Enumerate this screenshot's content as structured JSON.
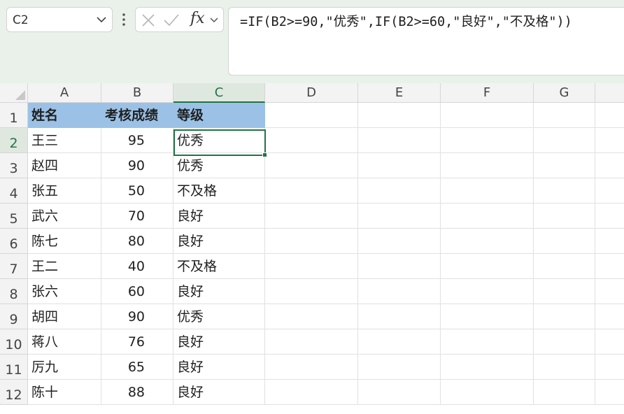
{
  "name_box": {
    "value": "C2"
  },
  "formula_bar": {
    "cancel_icon": "x-icon",
    "confirm_icon": "check-icon",
    "fx_label": "fx",
    "formula": "=IF(B2>=90,\"优秀\",IF(B2>=60,\"良好\",\"不及格\"))"
  },
  "columns": [
    "A",
    "B",
    "C",
    "D",
    "E",
    "F",
    "G"
  ],
  "selected_column": "C",
  "rows": [
    "1",
    "2",
    "3",
    "4",
    "5",
    "6",
    "7",
    "8",
    "9",
    "10",
    "11",
    "12"
  ],
  "selected_row": "2",
  "table": {
    "headers": [
      "姓名",
      "考核成绩",
      "等级"
    ],
    "data": [
      [
        "王三",
        "95",
        "优秀"
      ],
      [
        "赵四",
        "90",
        "优秀"
      ],
      [
        "张五",
        "50",
        "不及格"
      ],
      [
        "武六",
        "70",
        "良好"
      ],
      [
        "陈七",
        "80",
        "良好"
      ],
      [
        "王二",
        "40",
        "不及格"
      ],
      [
        "张六",
        "60",
        "良好"
      ],
      [
        "胡四",
        "90",
        "优秀"
      ],
      [
        "蒋八",
        "76",
        "良好"
      ],
      [
        "厉九",
        "65",
        "良好"
      ],
      [
        "陈十",
        "88",
        "良好"
      ]
    ]
  },
  "colors": {
    "header_fill": "#9bc2e6",
    "selection": "#217346",
    "toolbar_bg": "#eaf0ea"
  }
}
